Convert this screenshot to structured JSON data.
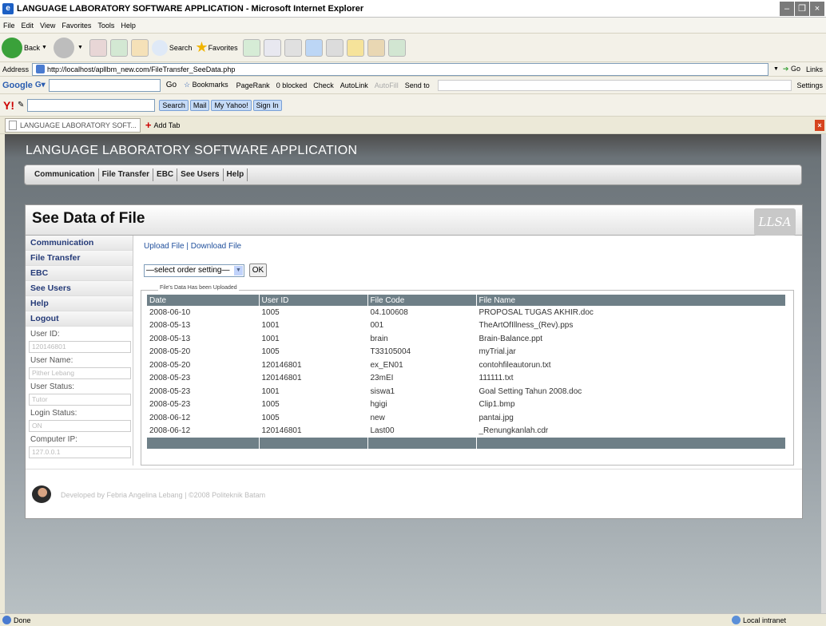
{
  "window": {
    "title": "LANGUAGE LABORATORY SOFTWARE APPLICATION - Microsoft Internet Explorer"
  },
  "menu": [
    "File",
    "Edit",
    "View",
    "Favorites",
    "Tools",
    "Help"
  ],
  "toolbar": {
    "back": "Back",
    "search": "Search",
    "favorites": "Favorites"
  },
  "address": {
    "label": "Address",
    "url": "http://localhost/apllbm_new.com/FileTransfer_SeeData.php",
    "go": "Go",
    "links": "Links"
  },
  "google": {
    "logo": "Google",
    "go": "Go",
    "bookmarks": "Bookmarks",
    "pagerank": "PageRank",
    "blocked": "0 blocked",
    "check": "Check",
    "autolink": "AutoLink",
    "autofill": "AutoFill",
    "sendto": "Send to",
    "settings": "Settings"
  },
  "yahoo": {
    "logo": "Y!",
    "search": "Search",
    "mail": "Mail",
    "myyahoo": "My Yahoo!",
    "signin": "Sign In"
  },
  "tabs": {
    "current": "LANGUAGE LABORATORY SOFT...",
    "add": "Add Tab"
  },
  "app": {
    "title": "LANGUAGE LABORATORY SOFTWARE APPLICATION",
    "nav": [
      "Communication",
      "File Transfer",
      "EBC",
      "See Users",
      "Help"
    ],
    "page_title": "See Data of File",
    "logo": "LLSA"
  },
  "sidebar": {
    "items": [
      "Communication",
      "File Transfer",
      "EBC",
      "See Users",
      "Help",
      "Logout"
    ],
    "fields": [
      {
        "label": "User ID:",
        "value": "120146801"
      },
      {
        "label": "User Name:",
        "value": "Pither Lebang"
      },
      {
        "label": "User Status:",
        "value": "Tutor"
      },
      {
        "label": "Login Status:",
        "value": "ON"
      },
      {
        "label": "Computer IP:",
        "value": "127.0.0.1"
      }
    ]
  },
  "main": {
    "upload": "Upload File",
    "sep": " | ",
    "download": "Download File",
    "select": "—select order setting—",
    "ok": "OK",
    "legend": "File's Data Has been Uploaded",
    "columns": [
      "Date",
      "User ID",
      "File Code",
      "File Name"
    ],
    "rows": [
      [
        "2008-06-10",
        "1005",
        "04.100608",
        "PROPOSAL TUGAS AKHIR.doc"
      ],
      [
        "2008-05-13",
        "1001",
        "001",
        "TheArtOfIllness_(Rev).pps"
      ],
      [
        "2008-05-13",
        "1001",
        "brain",
        "Brain-Balance.ppt"
      ],
      [
        "2008-05-20",
        "1005",
        "T33105004",
        "myTrial.jar"
      ],
      [
        "2008-05-20",
        "120146801",
        "ex_EN01",
        "contohfileautorun.txt"
      ],
      [
        "2008-05-23",
        "120146801",
        "23mEI",
        "111111.txt"
      ],
      [
        "2008-05-23",
        "1001",
        "siswa1",
        "Goal Setting Tahun 2008.doc"
      ],
      [
        "2008-05-23",
        "1005",
        "hgigi",
        "Clip1.bmp"
      ],
      [
        "2008-06-12",
        "1005",
        "new",
        "pantai.jpg"
      ],
      [
        "2008-06-12",
        "120146801",
        "Last00",
        "_Renungkanlah.cdr"
      ]
    ]
  },
  "footer": {
    "text": "Developed by Febria Angelina Lebang | ©2008 Politeknik Batam"
  },
  "status": {
    "left": "Done",
    "zone": "Local intranet"
  }
}
